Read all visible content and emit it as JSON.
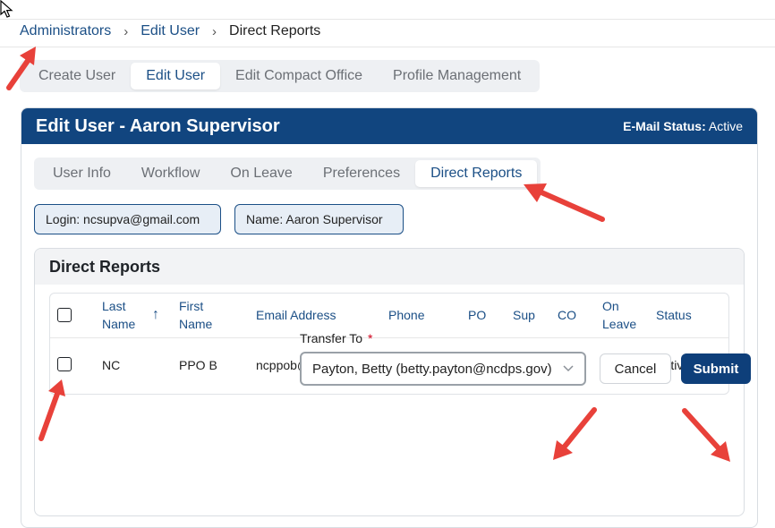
{
  "breadcrumb": {
    "items": [
      "Administrators",
      "Edit User",
      "Direct Reports"
    ],
    "separator": "›"
  },
  "top_tabs": [
    "Create User",
    "Edit User",
    "Edit Compact Office",
    "Profile Management"
  ],
  "top_tabs_active": "Edit User",
  "card": {
    "title": "Edit User - Aaron Supervisor",
    "email_status_label": "E-Mail Status:",
    "email_status_value": "Active",
    "header_color": "#11457f"
  },
  "inner_tabs": [
    "User Info",
    "Workflow",
    "On Leave",
    "Preferences",
    "Direct Reports"
  ],
  "inner_tabs_active": "Direct Reports",
  "chips": {
    "login": "Login: ncsupva@gmail.com",
    "name": "Name: Aaron Supervisor"
  },
  "direct_reports": {
    "title": "Direct Reports",
    "columns": {
      "last_name": "Last Name",
      "sort_icon": "↑",
      "first_name": "First Name",
      "email": "Email Address",
      "phone": "Phone",
      "po": "PO",
      "sup": "Sup",
      "co": "CO",
      "on_leave": "On Leave",
      "status": "Status"
    },
    "rows": [
      {
        "last_name": "NC",
        "first_name": "PPO B",
        "email": "ncppob@gmail.com",
        "phone": "",
        "po": false,
        "sup": false,
        "co": true,
        "on_leave": false,
        "status": "Active",
        "selected": false
      }
    ]
  },
  "transfer": {
    "label": "Transfer To",
    "required_mark": "*",
    "selected_value": "Payton, Betty (betty.payton@ncdps.gov)"
  },
  "buttons": {
    "cancel": "Cancel",
    "submit": "Submit"
  },
  "accent_color": "#1b4f86",
  "annotation_color": "#e8413a"
}
